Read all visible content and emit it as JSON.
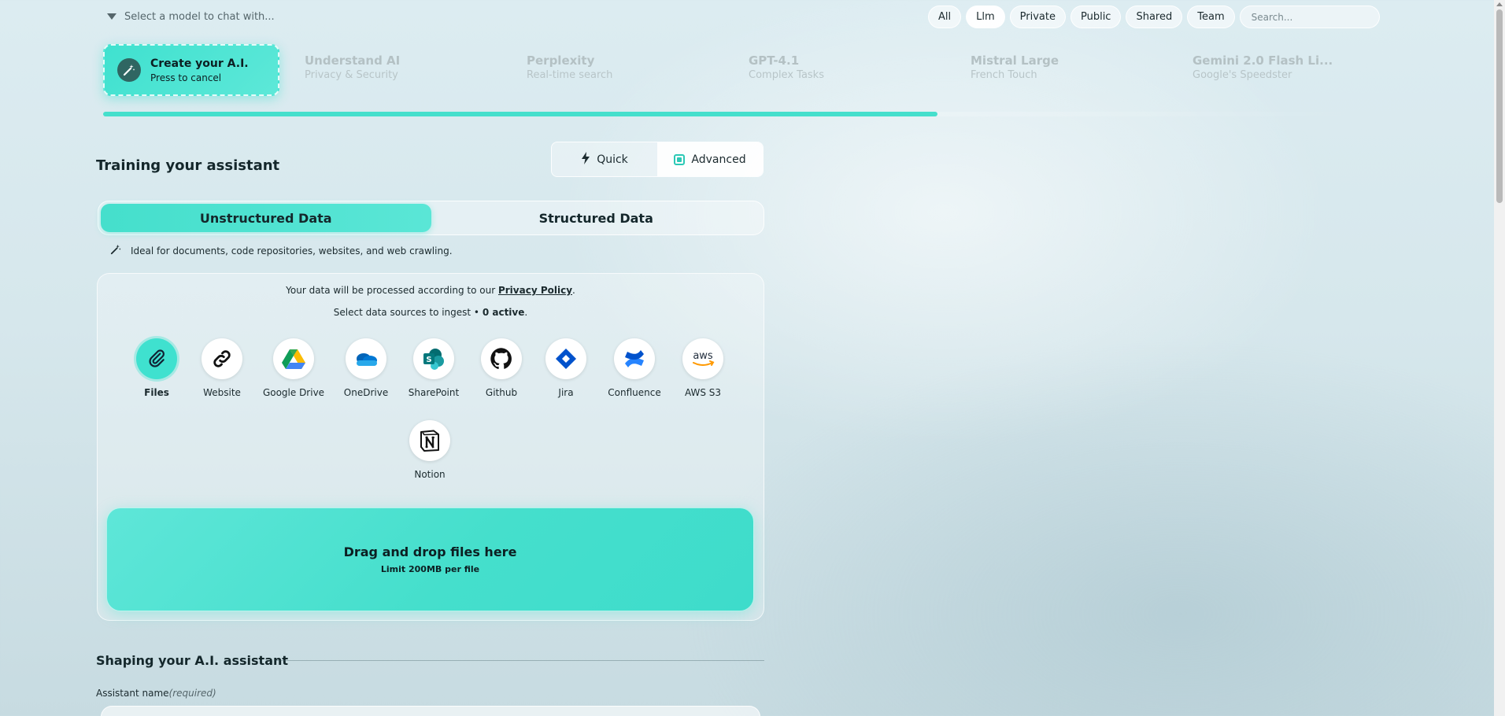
{
  "topbar": {
    "model_select_placeholder": "Select a model to chat with...",
    "filters": [
      "All",
      "Llm",
      "Private",
      "Public",
      "Shared",
      "Team"
    ],
    "active_filter": "Llm",
    "search_placeholder": "Search..."
  },
  "models": [
    {
      "title": "Create your A.I.",
      "subtitle": "Press to cancel",
      "icon": "magic-wand-icon"
    },
    {
      "title": "Understand AI",
      "subtitle": "Privacy & Security"
    },
    {
      "title": "Perplexity",
      "subtitle": "Real-time search"
    },
    {
      "title": "GPT-4.1",
      "subtitle": "Complex Tasks"
    },
    {
      "title": "Mistral Large",
      "subtitle": "French Touch"
    },
    {
      "title": "Gemini 2.0 Flash Li...",
      "subtitle": "Google's Speedster"
    }
  ],
  "training": {
    "title": "Training your assistant",
    "modes": [
      "Quick",
      "Advanced"
    ],
    "selected_mode": "Advanced",
    "data_tabs": [
      "Unstructured Data",
      "Structured Data"
    ],
    "selected_tab": "Unstructured Data",
    "hint": "Ideal for documents, code repositories, websites, and web crawling.",
    "privacy_prefix": "Your data will be processed according to our ",
    "privacy_link": "Privacy Policy",
    "privacy_suffix": ".",
    "select_prefix": "Select data sources to ingest • ",
    "active_count": "0 active",
    "select_suffix": ".",
    "sources": [
      {
        "label": "Files",
        "icon": "paperclip-icon"
      },
      {
        "label": "Website",
        "icon": "link-icon"
      },
      {
        "label": "Google Drive",
        "icon": "google-drive-icon"
      },
      {
        "label": "OneDrive",
        "icon": "onedrive-icon"
      },
      {
        "label": "SharePoint",
        "icon": "sharepoint-icon"
      },
      {
        "label": "Github",
        "icon": "github-icon"
      },
      {
        "label": "Jira",
        "icon": "jira-icon"
      },
      {
        "label": "Confluence",
        "icon": "confluence-icon"
      },
      {
        "label": "AWS S3",
        "icon": "aws-icon"
      },
      {
        "label": "Notion",
        "icon": "notion-icon"
      }
    ],
    "selected_source": "Files",
    "dropzone_title": "Drag and drop files here",
    "dropzone_limit": "Limit 200MB per file"
  },
  "shaping": {
    "title": "Shaping your A.I. assistant",
    "name_label": "Assistant name",
    "name_required": "(required)"
  },
  "colors": {
    "accent": "#45dfcc",
    "background": "#d6e7ec"
  }
}
